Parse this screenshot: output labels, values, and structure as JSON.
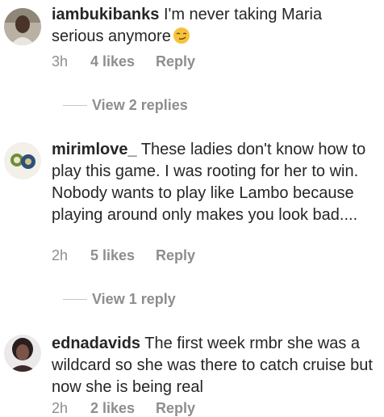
{
  "comments": [
    {
      "username": "iambukibanks",
      "text": "I'm never taking Maria serious anymore",
      "emoji": "smirk-face-emoji",
      "time": "3h",
      "likes": "4 likes",
      "reply": "Reply",
      "view_replies": "View 2 replies"
    },
    {
      "username": "mirimlove_",
      "text": "These ladies don't know how to play this game. I was rooting for her to win. Nobody wants to play like Lambo because playing around only makes you look bad....",
      "time": "2h",
      "likes": "5 likes",
      "reply": "Reply",
      "view_replies": "View 1 reply"
    },
    {
      "username": "ednadavids",
      "text": "The first week rmbr she was a wildcard  so she was there to catch cruise but now she is being  real",
      "time": "2h",
      "likes": "2 likes",
      "reply": "Reply"
    }
  ],
  "colors": {
    "text": "#262626",
    "meta": "#8e8e8e",
    "divider": "#c7c7c7"
  }
}
